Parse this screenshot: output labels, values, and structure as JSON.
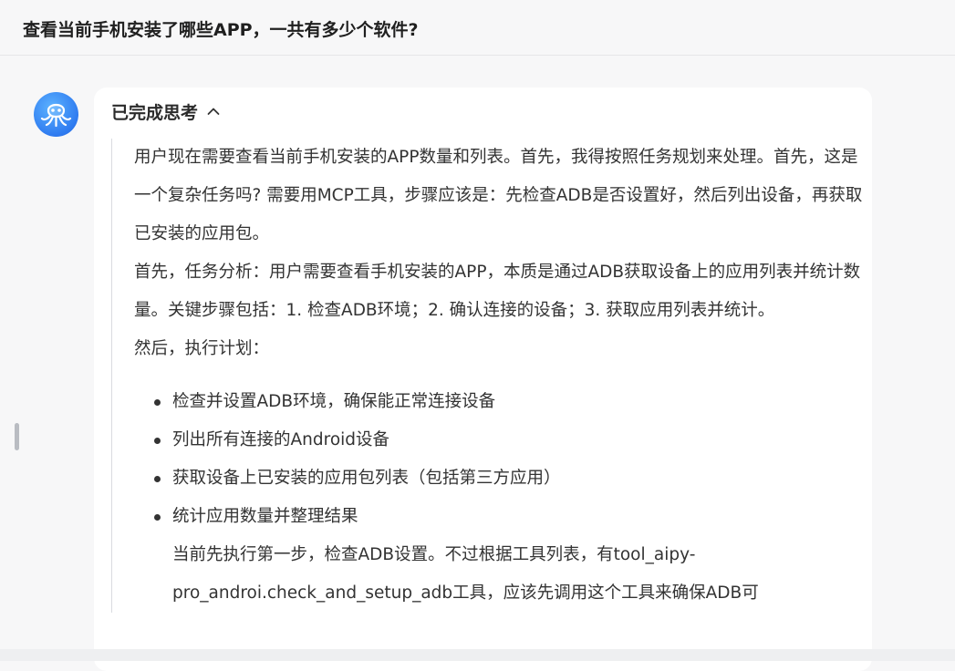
{
  "header": {
    "title": "查看当前手机安装了哪些APP，一共有多少个软件?"
  },
  "assistant": {
    "avatar_icon": "octopus-logo-icon",
    "thinking": {
      "label": "已完成思考",
      "toggle_icon": "chevron-up-icon"
    },
    "paragraphs": [
      "用户现在需要查看当前手机安装的APP数量和列表。首先，我得按照任务规划来处理。首先，这是一个复杂任务吗? 需要用MCP工具，步骤应该是：先检查ADB是否设置好，然后列出设备，再获取已安装的应用包。",
      "首先，任务分析：用户需要查看手机安装的APP，本质是通过ADB获取设备上的应用列表并统计数量。关键步骤包括：1. 检查ADB环境；2. 确认连接的设备；3. 获取应用列表并统计。",
      "然后，执行计划："
    ],
    "steps": [
      "检查并设置ADB环境，确保能正常连接设备",
      "列出所有连接的Android设备",
      "获取设备上已安装的应用包列表（包括第三方应用）",
      "统计应用数量并整理结果"
    ],
    "step_followup": "当前先执行第一步，检查ADB设置。不过根据工具列表，有tool_aipy-pro_androi.check_and_setup_adb工具，应该先调用这个工具来确保ADB可"
  }
}
